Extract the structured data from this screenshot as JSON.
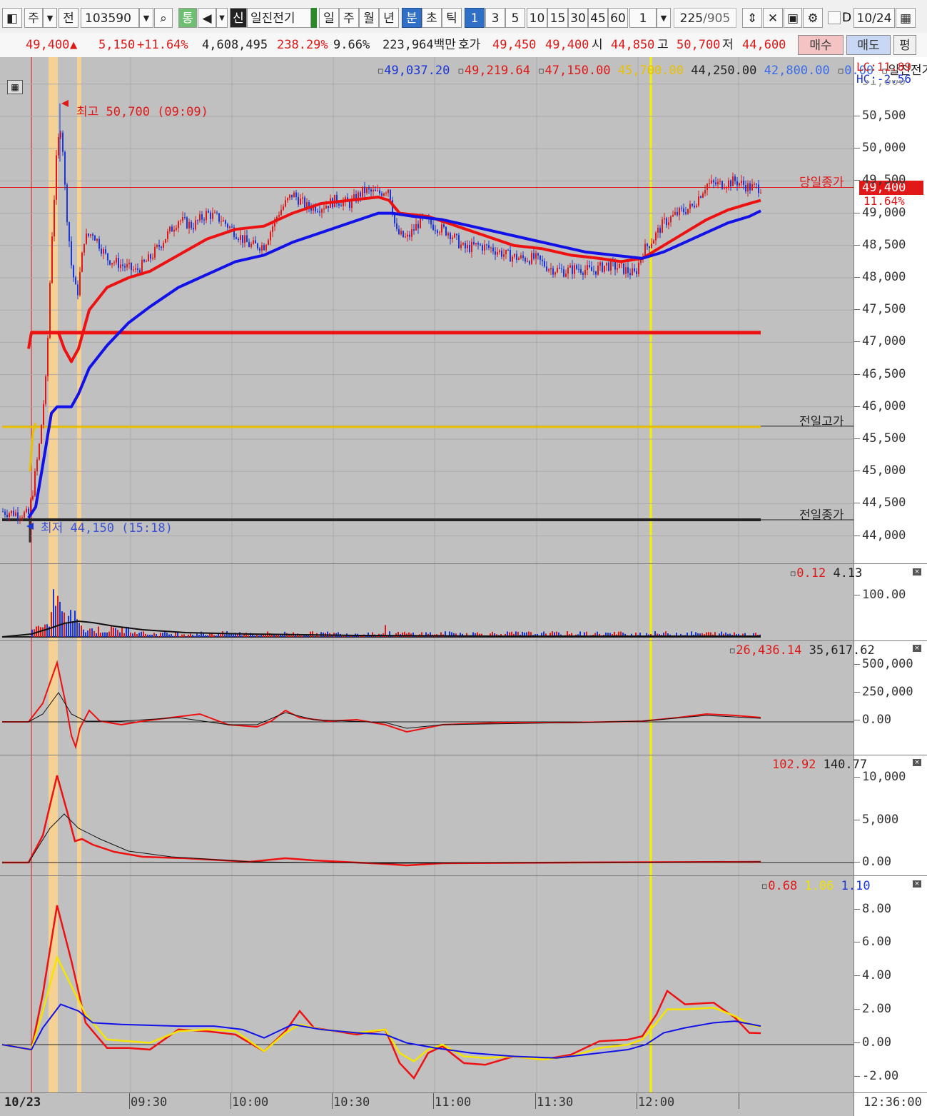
{
  "toolbar": {
    "market": "주",
    "prefix": "전",
    "code": "103590",
    "tong": "통",
    "sin": "신",
    "stock_name": "일진전기",
    "periods": [
      "일",
      "주",
      "월",
      "년",
      "분",
      "초",
      "틱"
    ],
    "period_selected": "분",
    "minutes": [
      "1",
      "3",
      "5",
      "10",
      "15",
      "30",
      "45",
      "60"
    ],
    "minute_selected": "1",
    "count_value": "1",
    "range": "225",
    "range_total": "/905",
    "d_label": "D",
    "date": "10/24"
  },
  "quote": {
    "price": "49,400",
    "change": "5,150",
    "change_pct": "+11.64%",
    "volume": "4,608,495",
    "vol_ratio": "238.29%",
    "turnover": "9.66%",
    "amount": "223,964백만",
    "hoga_label": "호가",
    "ask": "49,450",
    "bid": "49,400",
    "open_label": "시",
    "open": "44,850",
    "high_label": "고",
    "high": "50,700",
    "low_label": "저",
    "low": "44,600",
    "buy": "매수",
    "sell": "매도",
    "eval": "평"
  },
  "price_pane": {
    "legend": [
      "49,037.20",
      "49,219.64",
      "47,150.00",
      "45,700.00",
      "44,250.00",
      "42,800.00",
      "0.00"
    ],
    "legend_name": "일진전기",
    "lc": "LC:11.89",
    "hc": "HC:-2.56",
    "high_note": "최고 50,700 (09:09)",
    "low_note": "최저 44,150 (15:18)",
    "today_close_label": "당일종가",
    "prev_high_label": "전일고가",
    "prev_close_label": "전일종가",
    "price_tag": "49,400",
    "pct_tag": "11.64%",
    "axis": [
      "50,500",
      "50,000",
      "49,500",
      "49,000",
      "48,500",
      "48,000",
      "47,500",
      "47,000",
      "46,500",
      "46,000",
      "45,500",
      "45,000",
      "44,500",
      "44,000"
    ],
    "axis_top_partial": "51,000"
  },
  "volume_pane": {
    "legend_a": "0.12",
    "legend_b": "4.13",
    "axis": [
      "100.00"
    ]
  },
  "macd_pane": {
    "legend_a": "26,436.14",
    "legend_b": "35,617.62",
    "axis": [
      "500,000",
      "250,000",
      "0.00"
    ]
  },
  "osc_pane": {
    "legend_a": "102.92",
    "legend_b": "140.77",
    "axis": [
      "10,000",
      "5,000",
      "0.00"
    ]
  },
  "rsi_pane": {
    "legend_a": "0.68",
    "legend_b": "1.06",
    "legend_c": "1.10",
    "axis": [
      "8.00",
      "6.00",
      "4.00",
      "2.00",
      "0.00",
      "-2.00"
    ]
  },
  "time_axis": {
    "date": "10/23",
    "ticks": [
      "09:30",
      "10:00",
      "10:30",
      "11:00",
      "11:30",
      "12:00"
    ],
    "now": "12:36:00"
  },
  "colors": {
    "up": "#e01818",
    "down": "#1a35d8",
    "ma_short": "#ee1111",
    "ma_long": "#1212e8",
    "prev_high": "#e8c000",
    "highlight": "#ffd38c",
    "vline": "#f5f000"
  }
}
